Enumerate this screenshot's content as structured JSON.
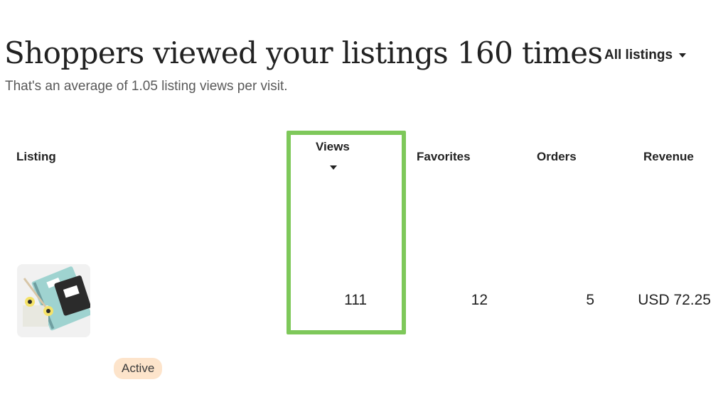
{
  "header": {
    "headline": "Shoppers viewed your listings 160 times",
    "subheadline": "That's an average of 1.05 listing views per visit.",
    "filter_label": "All listings"
  },
  "table": {
    "columns": {
      "listing": "Listing",
      "views": "Views",
      "favorites": "Favorites",
      "orders": "Orders",
      "revenue": "Revenue"
    },
    "sorted_by": "views",
    "rows": [
      {
        "thumbnail": "listing-thumbnail-image",
        "views": "111",
        "favorites": "12",
        "orders": "5",
        "revenue": "USD 72.25",
        "status": "Active"
      }
    ]
  },
  "highlight": {
    "column": "views",
    "color": "#7ec85a"
  },
  "colors": {
    "status_badge_bg": "#fde4cb",
    "text": "#222222",
    "muted_text": "#595959"
  },
  "icons": {
    "filter_caret": "caret-down-icon",
    "sort_caret": "sort-caret-down-icon"
  }
}
